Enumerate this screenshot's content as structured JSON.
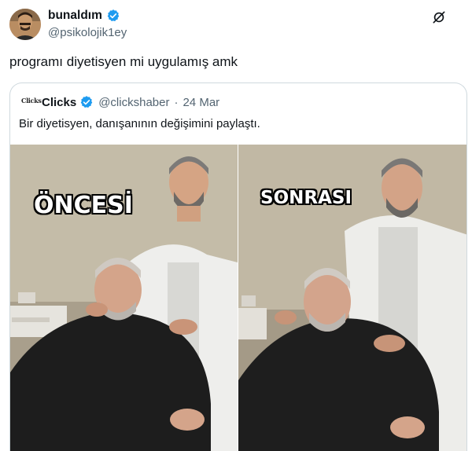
{
  "author": {
    "display_name": "bunaldım",
    "handle": "@psikolojik1ey",
    "avatar_icon": "user-avatar",
    "verified_icon": "verified-badge-icon"
  },
  "header_actions": {
    "grok_icon": "grok-icon"
  },
  "tweet": {
    "text": "programı diyetisyen mi uygulamış amk"
  },
  "quote": {
    "logo_text": "Clicks",
    "display_name": "Clicks",
    "handle": "@clickshaber",
    "separator": "·",
    "date": "24 Mar",
    "text": "Bir diyetisyen, danışanının değişimini paylaştı."
  },
  "media": {
    "before_label": "ÖNCESİ",
    "after_label": "SONRASI"
  },
  "colors": {
    "verified_blue": "#1d9bf0",
    "text_primary": "#0f1419",
    "text_secondary": "#536471",
    "border": "#cfd9de"
  }
}
